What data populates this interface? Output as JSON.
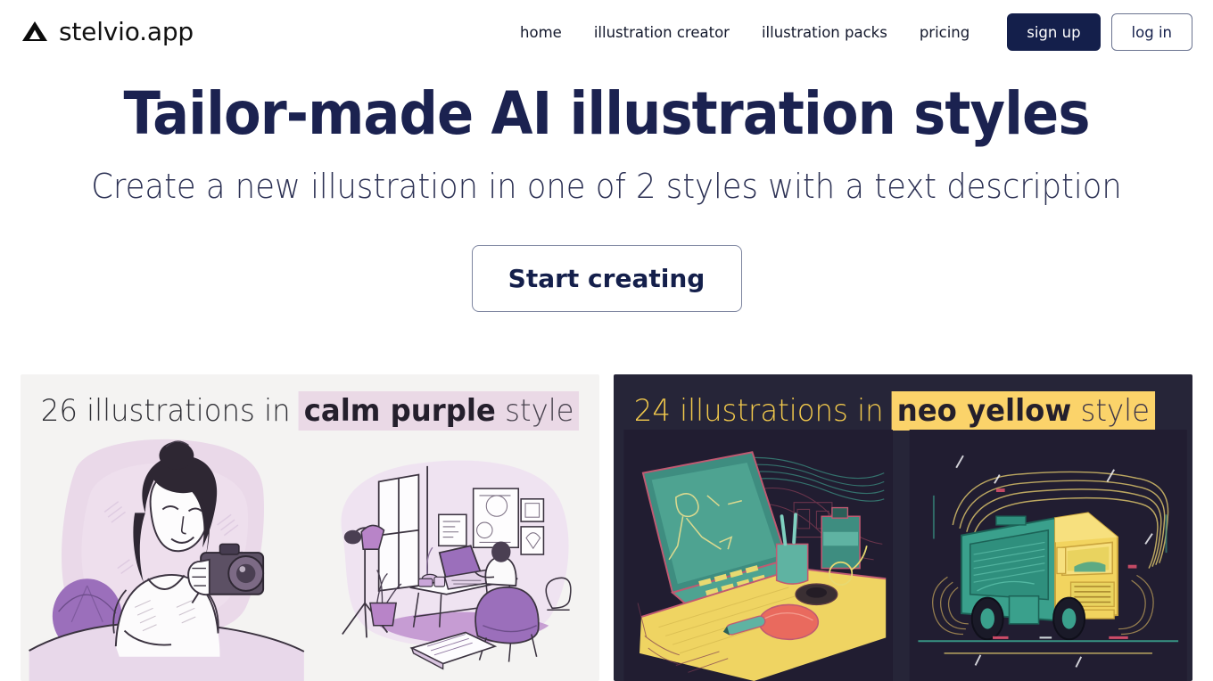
{
  "header": {
    "logo_icon": "triangle-mountain-icon",
    "brand_name": "stelvio.app",
    "nav": [
      {
        "label": "home"
      },
      {
        "label": "illustration creator"
      },
      {
        "label": "illustration packs"
      },
      {
        "label": "pricing"
      }
    ],
    "signup_label": "sign up",
    "login_label": "log in",
    "signup_bg": "#141f4b",
    "login_border": "#6a7390"
  },
  "hero": {
    "title": "Tailor-made AI illustration styles",
    "subtitle": "Create a new illustration in one of 2 styles with a text description",
    "cta_label": "Start creating",
    "title_color": "#1b2250"
  },
  "style_cards": [
    {
      "count_text": "26 illustrations in",
      "style_name": "calm purple",
      "style_suffix": "style",
      "background": "#f4f3f2",
      "highlight": "#ead9e6",
      "text_color": "#2f2f35",
      "illustrations": [
        {
          "alt": "woman-with-camera-illustration"
        },
        {
          "alt": "home-office-workspace-illustration"
        }
      ]
    },
    {
      "count_text": "24 illustrations in",
      "style_name": "neo yellow",
      "style_suffix": "style",
      "background": "#262538",
      "highlight": "#fbd36a",
      "text_color": "#f2c94c",
      "illustrations": [
        {
          "alt": "laptop-on-yellow-desk-illustration"
        },
        {
          "alt": "delivery-truck-illustration"
        }
      ]
    }
  ]
}
